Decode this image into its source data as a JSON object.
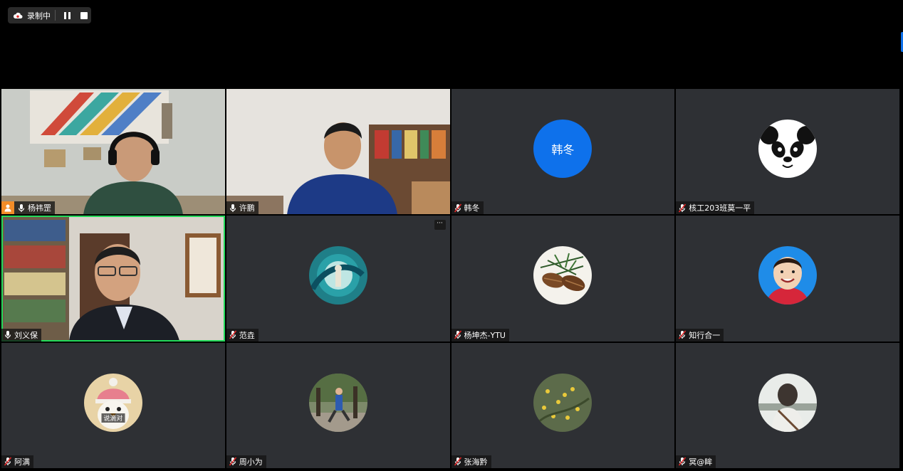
{
  "recording": {
    "label": "录制中",
    "icons": [
      "cloud-record-icon",
      "pause-icon",
      "stop-icon"
    ]
  },
  "colors": {
    "active_speaker": "#23d959",
    "avatar_blue": "#0e71eb",
    "host_orange": "#f28c28",
    "tile_bg": "#2e3034"
  },
  "participants": [
    {
      "name": "杨祎罡",
      "type": "video",
      "host": true,
      "mic": "on"
    },
    {
      "name": "许鹏",
      "type": "video",
      "mic": "on"
    },
    {
      "name": "韩冬",
      "type": "avatar-text",
      "avatar_text": "韩冬",
      "mic": "muted"
    },
    {
      "name": "核工203班莫一平",
      "type": "avatar-image",
      "avatar": "panda",
      "mic": "muted"
    },
    {
      "name": "刘义保",
      "type": "video",
      "active_speaker": true,
      "mic": "on"
    },
    {
      "name": "范垚",
      "type": "avatar-image",
      "avatar": "wave",
      "mic": "muted",
      "more_menu": "···"
    },
    {
      "name": "杨坤杰-YTU",
      "type": "avatar-image",
      "avatar": "pinecones",
      "mic": "muted"
    },
    {
      "name": "知行合一",
      "type": "avatar-image",
      "avatar": "child-photo",
      "mic": "muted"
    },
    {
      "name": "阿满",
      "type": "avatar-image",
      "avatar": "penguin",
      "avatar_caption": "说滴对",
      "mic": "muted"
    },
    {
      "name": "周小为",
      "type": "avatar-image",
      "avatar": "park-photo",
      "mic": "muted"
    },
    {
      "name": "张海黔",
      "type": "avatar-image",
      "avatar": "flowers",
      "mic": "muted"
    },
    {
      "name": "冥@眸",
      "type": "avatar-image",
      "avatar": "back-view",
      "mic": "muted"
    }
  ]
}
